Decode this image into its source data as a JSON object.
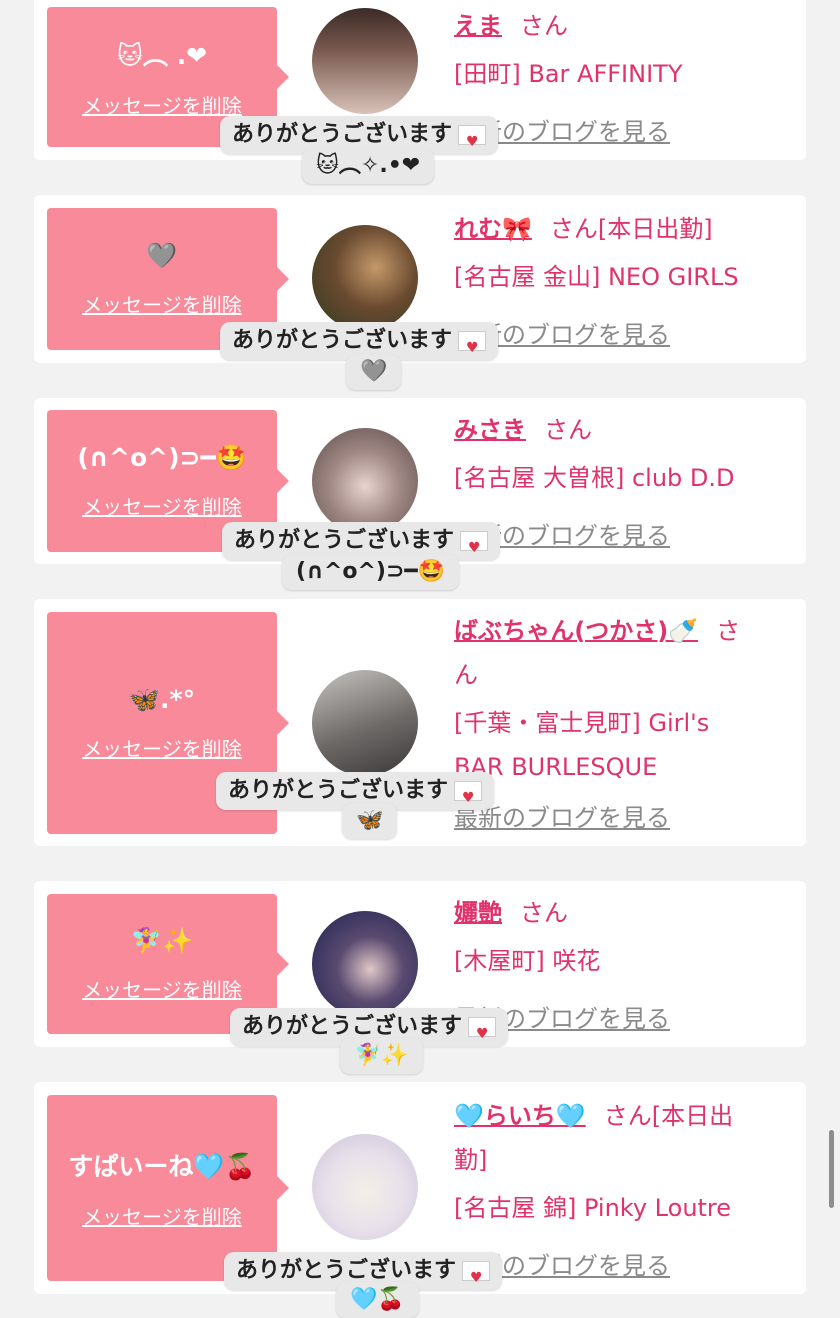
{
  "cards": [
    {
      "bubble_message": "🐱︵ .❤",
      "delete_label": "メッセージを削除",
      "name": "えま",
      "honorific": "さん",
      "status": "",
      "shop_line1": "[田町] Bar AFFINITY",
      "shop_line2": "",
      "blog_label": "最新のブログを見る",
      "toast_text": "ありがとうございます",
      "toast_emoji": "🐱︵✧.•❤",
      "avatar_colors": [
        "#3b2a26",
        "#d8c2b8"
      ]
    },
    {
      "bubble_message": "🩶",
      "delete_label": "メッセージを削除",
      "name": "れむ🎀",
      "honorific": "さん",
      "status": "[本日出勤]",
      "shop_line1": "[名古屋 金山] NEO GIRLS",
      "shop_line2": "",
      "blog_label": "最新のブログを見る",
      "toast_text": "ありがとうございます",
      "toast_emoji": "🩶",
      "avatar_colors": [
        "#2f3a1e",
        "#c49a6a"
      ]
    },
    {
      "bubble_message": "(∩^o^)⊃━🤩",
      "delete_label": "メッセージを削除",
      "name": "みさき",
      "honorific": "さん",
      "status": "",
      "shop_line1": "[名古屋 大曽根] club D.D",
      "shop_line2": "",
      "blog_label": "最新のブログを見る",
      "toast_text": "ありがとうございます",
      "toast_emoji": "(∩^o^)⊃━🤩",
      "avatar_colors": [
        "#5a4a48",
        "#e8d4d0"
      ]
    },
    {
      "bubble_message": "🦋.*°",
      "delete_label": "メッセージを削除",
      "name": "ばぶちゃん(つかさ)🍼",
      "honorific": "さ",
      "status": "",
      "name_wrap": "ん",
      "shop_line1": "[千葉・富士見町] Girl's",
      "shop_line2": "BAR BURLESQUE",
      "blog_label": "最新のブログを見る",
      "toast_text": "ありがとうございます",
      "toast_emoji": "🦋",
      "avatar_colors": [
        "#6d6a68",
        "#c8c4c0"
      ]
    },
    {
      "bubble_message": "🧚‍♀️✨",
      "delete_label": "メッセージを削除",
      "name": "孋艶",
      "honorific": "さん",
      "status": "",
      "shop_line1": "[木屋町] 咲花",
      "shop_line2": "",
      "blog_label": "最新のブログを見る",
      "toast_text": "ありがとうございます",
      "toast_emoji": "🧚‍♀️✨",
      "avatar_colors": [
        "#1c2150",
        "#e0c8c8"
      ]
    },
    {
      "bubble_message": "すぱいーね🩵🍒",
      "delete_label": "メッセージを削除",
      "name": "🩵らいち🩵",
      "honorific": "さん",
      "status": "[本日出",
      "name_wrap": "勤]",
      "shop_line1": "[名古屋 錦] Pinky Loutre",
      "shop_line2": "",
      "blog_label": "最新のブログを見る",
      "toast_text": "ありがとうございます",
      "toast_emoji": "🩵🍒",
      "avatar_colors": [
        "#e7e0ea",
        "#f4efe8"
      ]
    }
  ]
}
